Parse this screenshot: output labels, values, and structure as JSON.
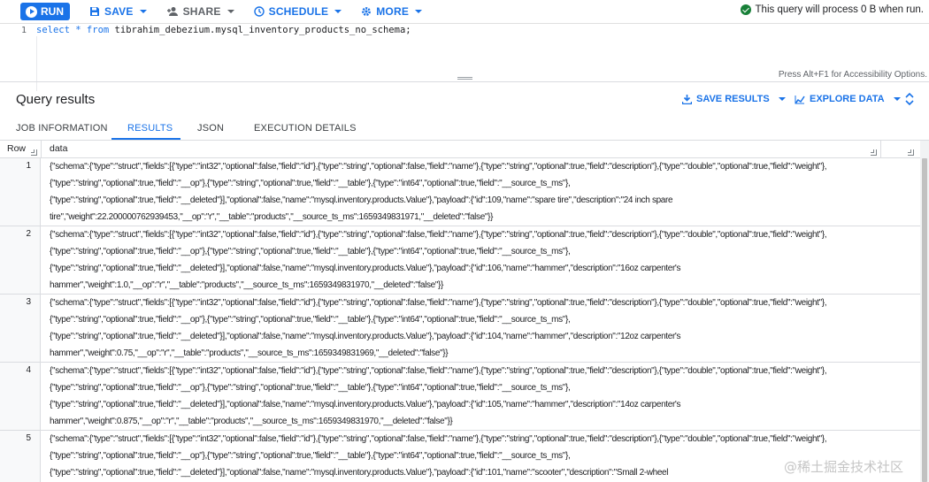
{
  "toolbar": {
    "run_label": "RUN",
    "save_label": "SAVE",
    "share_label": "SHARE",
    "schedule_label": "SCHEDULE",
    "more_label": "MORE",
    "status_text": "This query will process 0 B when run."
  },
  "editor": {
    "line_number": "1",
    "keyword_select": "select",
    "keyword_star": "*",
    "keyword_from": "from",
    "table_ref": "tibrahim_debezium.mysql_inventory_products_no_schema;",
    "accessibility_hint": "Press Alt+F1 for Accessibility Options."
  },
  "results": {
    "title": "Query results",
    "save_results_label": "SAVE RESULTS",
    "explore_data_label": "EXPLORE DATA"
  },
  "tabs": [
    {
      "label": "JOB INFORMATION",
      "active": false
    },
    {
      "label": "RESULTS",
      "active": true
    },
    {
      "label": "JSON",
      "active": false
    },
    {
      "label": "EXECUTION DETAILS",
      "active": false
    }
  ],
  "table": {
    "columns": [
      "Row",
      "data"
    ],
    "rows": [
      {
        "row": "1",
        "lines": [
          "{\"schema\":{\"type\":\"struct\",\"fields\":[{\"type\":\"int32\",\"optional\":false,\"field\":\"id\"},{\"type\":\"string\",\"optional\":false,\"field\":\"name\"},{\"type\":\"string\",\"optional\":true,\"field\":\"description\"},{\"type\":\"double\",\"optional\":true,\"field\":\"weight\"},",
          "{\"type\":\"string\",\"optional\":true,\"field\":\"__op\"},{\"type\":\"string\",\"optional\":true,\"field\":\"__table\"},{\"type\":\"int64\",\"optional\":true,\"field\":\"__source_ts_ms\"},",
          "{\"type\":\"string\",\"optional\":true,\"field\":\"__deleted\"}],\"optional\":false,\"name\":\"mysql.inventory.products.Value\"},\"payload\":{\"id\":109,\"name\":\"spare tire\",\"description\":\"24 inch spare",
          "tire\",\"weight\":22.200000762939453,\"__op\":\"r\",\"__table\":\"products\",\"__source_ts_ms\":1659349831971,\"__deleted\":\"false\"}}"
        ]
      },
      {
        "row": "2",
        "lines": [
          "{\"schema\":{\"type\":\"struct\",\"fields\":[{\"type\":\"int32\",\"optional\":false,\"field\":\"id\"},{\"type\":\"string\",\"optional\":false,\"field\":\"name\"},{\"type\":\"string\",\"optional\":true,\"field\":\"description\"},{\"type\":\"double\",\"optional\":true,\"field\":\"weight\"},",
          "{\"type\":\"string\",\"optional\":true,\"field\":\"__op\"},{\"type\":\"string\",\"optional\":true,\"field\":\"__table\"},{\"type\":\"int64\",\"optional\":true,\"field\":\"__source_ts_ms\"},",
          "{\"type\":\"string\",\"optional\":true,\"field\":\"__deleted\"}],\"optional\":false,\"name\":\"mysql.inventory.products.Value\"},\"payload\":{\"id\":106,\"name\":\"hammer\",\"description\":\"16oz carpenter's",
          "hammer\",\"weight\":1.0,\"__op\":\"r\",\"__table\":\"products\",\"__source_ts_ms\":1659349831970,\"__deleted\":\"false\"}}"
        ]
      },
      {
        "row": "3",
        "lines": [
          "{\"schema\":{\"type\":\"struct\",\"fields\":[{\"type\":\"int32\",\"optional\":false,\"field\":\"id\"},{\"type\":\"string\",\"optional\":false,\"field\":\"name\"},{\"type\":\"string\",\"optional\":true,\"field\":\"description\"},{\"type\":\"double\",\"optional\":true,\"field\":\"weight\"},",
          "{\"type\":\"string\",\"optional\":true,\"field\":\"__op\"},{\"type\":\"string\",\"optional\":true,\"field\":\"__table\"},{\"type\":\"int64\",\"optional\":true,\"field\":\"__source_ts_ms\"},",
          "{\"type\":\"string\",\"optional\":true,\"field\":\"__deleted\"}],\"optional\":false,\"name\":\"mysql.inventory.products.Value\"},\"payload\":{\"id\":104,\"name\":\"hammer\",\"description\":\"12oz carpenter's",
          "hammer\",\"weight\":0.75,\"__op\":\"r\",\"__table\":\"products\",\"__source_ts_ms\":1659349831969,\"__deleted\":\"false\"}}"
        ]
      },
      {
        "row": "4",
        "lines": [
          "{\"schema\":{\"type\":\"struct\",\"fields\":[{\"type\":\"int32\",\"optional\":false,\"field\":\"id\"},{\"type\":\"string\",\"optional\":false,\"field\":\"name\"},{\"type\":\"string\",\"optional\":true,\"field\":\"description\"},{\"type\":\"double\",\"optional\":true,\"field\":\"weight\"},",
          "{\"type\":\"string\",\"optional\":true,\"field\":\"__op\"},{\"type\":\"string\",\"optional\":true,\"field\":\"__table\"},{\"type\":\"int64\",\"optional\":true,\"field\":\"__source_ts_ms\"},",
          "{\"type\":\"string\",\"optional\":true,\"field\":\"__deleted\"}],\"optional\":false,\"name\":\"mysql.inventory.products.Value\"},\"payload\":{\"id\":105,\"name\":\"hammer\",\"description\":\"14oz carpenter's",
          "hammer\",\"weight\":0.875,\"__op\":\"r\",\"__table\":\"products\",\"__source_ts_ms\":1659349831970,\"__deleted\":\"false\"}}"
        ]
      },
      {
        "row": "5",
        "lines": [
          "{\"schema\":{\"type\":\"struct\",\"fields\":[{\"type\":\"int32\",\"optional\":false,\"field\":\"id\"},{\"type\":\"string\",\"optional\":false,\"field\":\"name\"},{\"type\":\"string\",\"optional\":true,\"field\":\"description\"},{\"type\":\"double\",\"optional\":true,\"field\":\"weight\"},",
          "{\"type\":\"string\",\"optional\":true,\"field\":\"__op\"},{\"type\":\"string\",\"optional\":true,\"field\":\"__table\"},{\"type\":\"int64\",\"optional\":true,\"field\":\"__source_ts_ms\"},",
          "{\"type\":\"string\",\"optional\":true,\"field\":\"__deleted\"}],\"optional\":false,\"name\":\"mysql.inventory.products.Value\"},\"payload\":{\"id\":101,\"name\":\"scooter\",\"description\":\"Small 2-wheel"
        ]
      }
    ]
  },
  "watermark": "@稀土掘金技术社区",
  "icons": {
    "run": "play-icon",
    "save": "save-icon",
    "share": "person-add-icon",
    "schedule": "clock-icon",
    "more": "gear-icon",
    "status": "check-circle-icon",
    "save_results": "download-icon",
    "explore_data": "chart-icon",
    "expand": "expand-icon"
  },
  "colors": {
    "accent": "#1a73e8",
    "success": "#188038"
  }
}
